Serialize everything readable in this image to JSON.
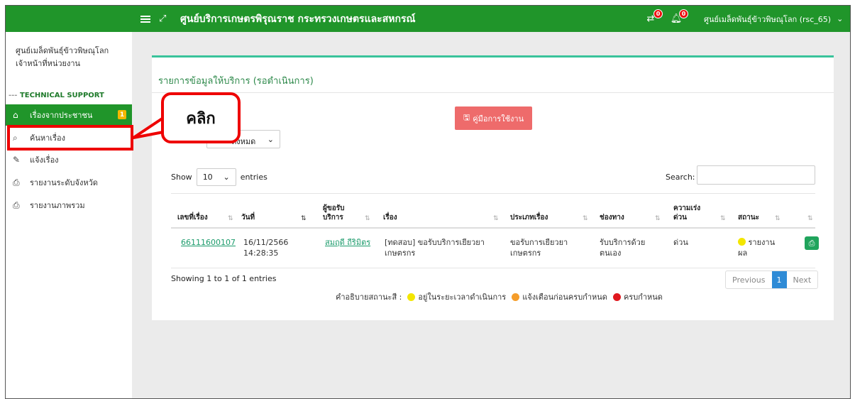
{
  "topbar": {
    "title": "ศูนย์บริการเกษตรพิรุณราช กระทรวงเกษตรและสหกรณ์",
    "notif_a_count": "0",
    "notif_b_count": "0",
    "user_label": "ศูนย์เมล็ดพันธุ์ข้าวพิษณุโลก (rsc_65)",
    "accent_color": "#20952a"
  },
  "sidebar": {
    "org_name": "ศูนย์เมล็ดพันธุ์ข้าวพิษณุโลก",
    "org_role": "เจ้าหน้าที่หน่วยงาน",
    "section_title": "TECHNICAL SUPPORT",
    "items": [
      {
        "label": "เรื่องจากประชาชน",
        "icon": "home-icon",
        "badge": "1",
        "active": true
      },
      {
        "label": "ค้นหาเรื่อง",
        "icon": "search-icon"
      },
      {
        "label": "แจ้งเรื่อง",
        "icon": "edit-icon"
      },
      {
        "label": "รายงานระดับจังหวัด",
        "icon": "printer-icon"
      },
      {
        "label": "รายงานภาพรวม",
        "icon": "printer-icon"
      }
    ]
  },
  "callout": {
    "text": "คลิก"
  },
  "main": {
    "title": "รายการข้อมูลให้บริการ (รอดำเนินการ)",
    "manual_button": "คู่มือการใช้งาน",
    "filter_value": "ทั้งหมด",
    "show_label": "Show",
    "show_value": "10",
    "entries_label": "entries",
    "search_label": "Search:",
    "columns": [
      "เลขที่เรื่อง",
      "วันที่",
      "ผู้ขอรับ",
      "บริการ",
      "เรื่อง",
      "ประเภทเรื่อง",
      "ช่องทาง",
      "ความเร่ง",
      "ด่วน",
      "สถานะ"
    ],
    "row": {
      "id": "66111600107",
      "date": "16/11/2566",
      "time": "14:28:35",
      "requester": "สมฤดี ถีริมิตร",
      "subject_1": "[ทดสอบ] ขอรับบริการเยียวยา",
      "subject_2": "เกษตรกร",
      "type_1": "ขอรับการเยียวยา",
      "type_2": "เกษตรกร",
      "channel_1": "รับบริการด้วย",
      "channel_2": "ตนเอง",
      "urgency": "ด่วน",
      "status_1": "รายงาน",
      "status_2": "ผล",
      "status_color": "#f3e600"
    },
    "info": "Showing 1 to 1 of 1 entries",
    "pager": {
      "prev": "Previous",
      "current": "1",
      "next": "Next"
    },
    "legend": {
      "label": "คำอธิบายสถานะสี :",
      "items": [
        {
          "label": "อยู่ในระยะเวลาดำเนินการ",
          "color": "#f3e600"
        },
        {
          "label": "แจ้งเตือนก่อนครบกำหนด",
          "color": "#f59d2a"
        },
        {
          "label": "ครบกำหนด",
          "color": "#e0191f"
        }
      ]
    }
  }
}
